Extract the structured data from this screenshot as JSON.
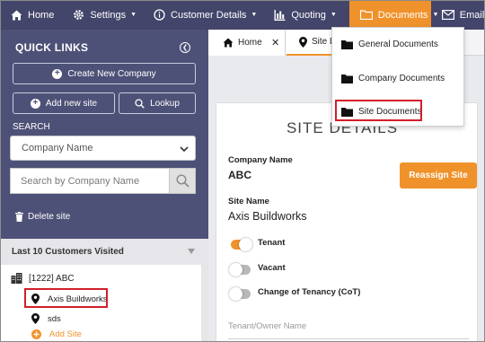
{
  "nav": {
    "home": "Home",
    "settings": "Settings",
    "customer_details": "Customer Details",
    "quoting": "Quoting",
    "documents": "Documents",
    "emails": "Emails"
  },
  "dropdown": {
    "items": [
      "General Documents",
      "Company Documents",
      "Site Documents"
    ]
  },
  "sidebar": {
    "title": "QUICK LINKS",
    "create_company": "Create New Company",
    "add_site": "Add new site",
    "lookup": "Lookup",
    "search_label": "SEARCH",
    "company_select": "Company Name",
    "search_placeholder": "Search by Company Name",
    "delete_site": "Delete site",
    "recent_title": "Last 10 Customers Visited",
    "recent_company": "[1222] ABC",
    "sites": [
      "Axis Buildworks",
      "sds"
    ],
    "add_site_link": "Add Site"
  },
  "tabs": {
    "home": "Home",
    "site": "Site Details"
  },
  "site_details": {
    "title": "SITE DETAILS",
    "company_label": "Company Name",
    "company_value": "ABC",
    "reassign": "Reassign Site",
    "site_label": "Site Name",
    "site_value": "Axis Buildworks",
    "toggles": [
      {
        "label": "Tenant",
        "on": true
      },
      {
        "label": "Vacant",
        "on": false
      },
      {
        "label": "Change of Tenancy (CoT)",
        "on": false
      }
    ],
    "owner_placeholder": "Tenant/Owner Name"
  },
  "colors": {
    "nav_bg": "#44456b",
    "sidebar_bg": "#4e5177",
    "accent": "#f0922b",
    "highlight": "#d11f2a"
  }
}
